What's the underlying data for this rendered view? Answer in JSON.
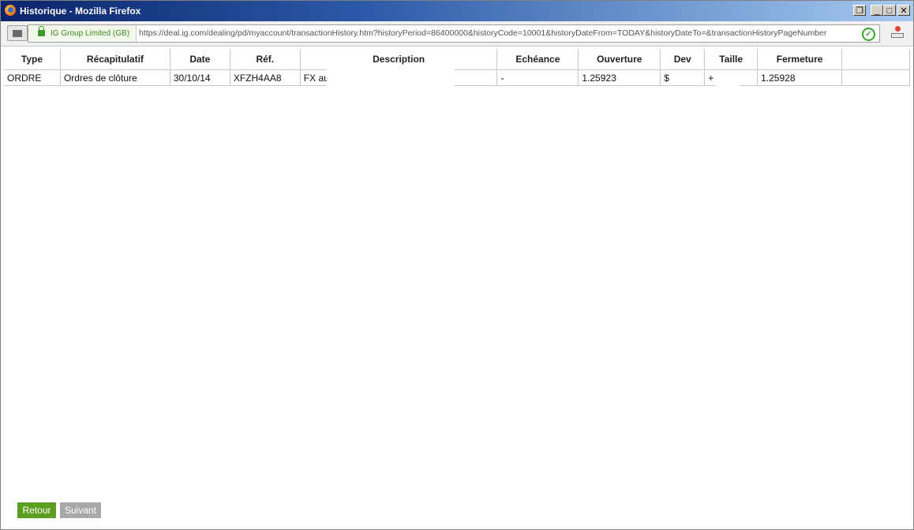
{
  "window": {
    "title": "Historique - Mozilla Firefox",
    "controls": [
      "restore",
      "minimize",
      "maximize",
      "close"
    ]
  },
  "nav": {
    "identity_label": "IG Group Limited (GB)",
    "url": "https://deal.ig.com/dealing/pd/myaccount/transactionHistory.htm?historyPeriod=86400000&historyCode=10001&historyDateFrom=TODAY&historyDateTo=&transactionHistoryPageNumber"
  },
  "table": {
    "headers": [
      "Type",
      "Récapitulatif",
      "Date",
      "Réf.",
      "Description",
      "Echéance",
      "Ouverture",
      "Dev",
      "Taille",
      "Fermeture"
    ],
    "rows": [
      [
        "ORDRE",
        "Ordres de clôture",
        "30/10/14",
        "XFZH4AA8",
        "FX au",
        "-",
        "1.25923",
        "$",
        "+",
        "1.25928"
      ]
    ]
  },
  "buttons": {
    "back_label": "Retour",
    "next_label": "Suivant"
  }
}
